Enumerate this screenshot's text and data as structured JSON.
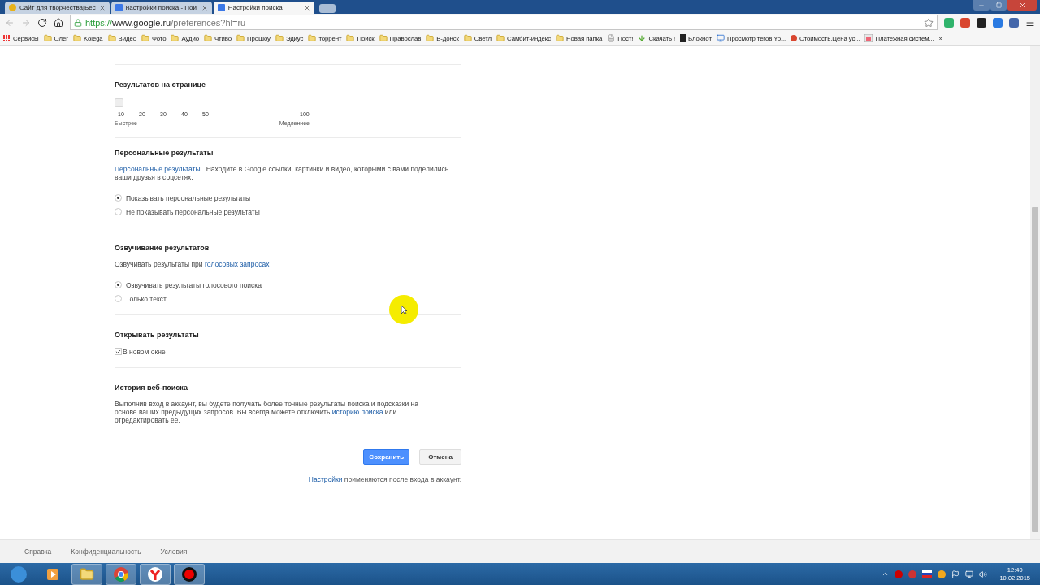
{
  "tabs": [
    {
      "title": "Сайт для творчества|Бес",
      "selected": false
    },
    {
      "title": "настройки поиска - Пои",
      "selected": false
    },
    {
      "title": "Настройки поиска",
      "selected": true
    }
  ],
  "address": {
    "scheme": "https://",
    "host": "www.google.ru",
    "path": "/preferences?hl=ru"
  },
  "bookmarks": [
    {
      "label": "Сервисы",
      "kind": "apps"
    },
    {
      "label": "Олег",
      "kind": "folder"
    },
    {
      "label": "Kolega",
      "kind": "folder"
    },
    {
      "label": "Видео",
      "kind": "folder"
    },
    {
      "label": "Фото",
      "kind": "folder"
    },
    {
      "label": "Аудио",
      "kind": "folder"
    },
    {
      "label": "Чтиво",
      "kind": "folder"
    },
    {
      "label": "ПроШоу",
      "kind": "folder"
    },
    {
      "label": "Эдиус",
      "kind": "folder"
    },
    {
      "label": "торрент",
      "kind": "folder"
    },
    {
      "label": "Поиск",
      "kind": "folder"
    },
    {
      "label": "Православ",
      "kind": "folder"
    },
    {
      "label": "В-донск",
      "kind": "folder"
    },
    {
      "label": "Светл",
      "kind": "folder"
    },
    {
      "label": "Самбит-индекс",
      "kind": "folder"
    },
    {
      "label": "Новая папка",
      "kind": "folder"
    },
    {
      "label": "Пост!",
      "kind": "page"
    },
    {
      "label": "Скачать !",
      "kind": "download"
    },
    {
      "label": "Блокнот",
      "kind": "notepad"
    },
    {
      "label": "Просмотр тегов Yo...",
      "kind": "monitor"
    },
    {
      "label": "Стоимость.Цена ус...",
      "kind": "ball"
    },
    {
      "label": "Платежная систем...",
      "kind": "payment"
    }
  ],
  "bookmarks_more": "»",
  "results_per_page": {
    "title": "Результатов на странице",
    "ticks": [
      "10",
      "20",
      "30",
      "40",
      "50",
      "100"
    ],
    "level": 0,
    "left_hint": "Быстрее",
    "right_hint": "Медленнее"
  },
  "personal": {
    "title": "Персональные результаты",
    "link": "Персональные результаты",
    "text": " . Находите в Google ссылки, картинки и видео, которыми с вами поделились ваши друзья в соцсетях.",
    "options": [
      {
        "label": "Показывать персональные результаты",
        "selected": true
      },
      {
        "label": "Не показывать персональные результаты",
        "selected": false
      }
    ]
  },
  "voice": {
    "title": "Озвучивание результатов",
    "text": "Озвучивать результаты при ",
    "link": "голосовых запросах",
    "options": [
      {
        "label": "Озвучивать результаты голосового поиска",
        "selected": true
      },
      {
        "label": "Только текст",
        "selected": false
      }
    ]
  },
  "open_results": {
    "title": "Открывать результаты",
    "checkbox": {
      "label": "В новом окне",
      "checked": true
    }
  },
  "history": {
    "title": "История веб-поиска",
    "text_before": "Выполнив вход в аккаунт, вы будете получать более точные результаты поиска и подсказки на основе ваших предыдущих запросов. Вы всегда можете отключить ",
    "link": "историю поиска",
    "text_after": " или отредактировать ее."
  },
  "buttons": {
    "save": "Сохранить",
    "cancel": "Отмена"
  },
  "note": {
    "link": "Настройки",
    "text": " применяются после входа в аккаунт."
  },
  "footer": [
    "Справка",
    "Конфиденциальность",
    "Условия"
  ],
  "clock": {
    "time": "12:40",
    "date": "10.02.2015"
  }
}
